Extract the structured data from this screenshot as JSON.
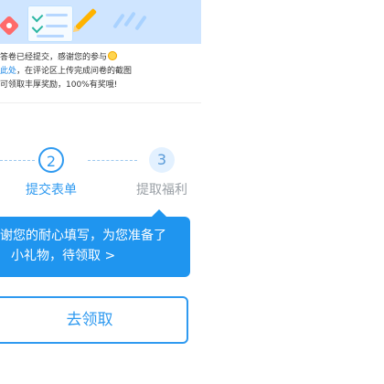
{
  "banner": {
    "icons": [
      "ticket-icon",
      "checklist-document-icon",
      "pencil-icon"
    ],
    "colors": {
      "background": "#cfe5ff",
      "accent": "#ff6a6a",
      "pencil": "#ffb300"
    }
  },
  "message": {
    "line1": "答卷已经提交，感谢您的参与",
    "line2_link": "此处",
    "line2_rest": "，在评论区上传完成问卷的截图",
    "line3": "可领取丰厚奖励，100%有奖哦!"
  },
  "steps": {
    "step2": {
      "number": "2",
      "label": "提交表单"
    },
    "step3": {
      "number": "3",
      "label": "提取福利"
    }
  },
  "bubble": {
    "line1": "谢您的耐心填写，为您准备了",
    "line2": "小礼物，待领取 >"
  },
  "button": {
    "label": "去领取"
  },
  "colors": {
    "primary": "#2f9af0",
    "bubble": "#1f95ef",
    "muted": "#9aa0a6"
  }
}
